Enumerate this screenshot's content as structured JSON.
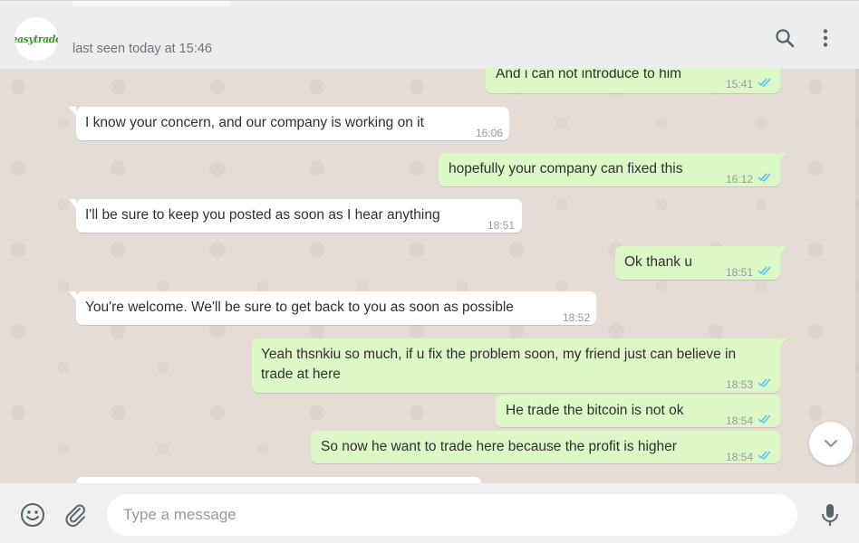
{
  "header": {
    "avatar_logo_text": "easytrade",
    "last_seen": "last seen today at 15:46",
    "icons": [
      "search-icon",
      "menu-dots-icon"
    ]
  },
  "colors": {
    "incoming_bubble": "#ffffff",
    "outgoing_bubble": "#dcf8c6",
    "read_tick": "#4fc3f7",
    "chat_background": "#e5ddd5",
    "logo_green": "#3b9c2a"
  },
  "messages": [
    {
      "direction": "out",
      "text": "And i can not introduce to him",
      "time": "15:41",
      "status": "read"
    },
    {
      "direction": "in",
      "text": "I know your concern, and our company is working on it",
      "time": "16:06"
    },
    {
      "direction": "out",
      "text": "hopefully your company can fixed this",
      "time": "16:12",
      "status": "read"
    },
    {
      "direction": "in",
      "text": "I'll be sure to keep you posted as soon as I hear anything",
      "time": "18:51"
    },
    {
      "direction": "out",
      "text": "Ok thank u",
      "time": "18:51",
      "status": "read"
    },
    {
      "direction": "in",
      "text": "You're welcome. We'll be sure to get back to you as soon as possible",
      "time": "18:52"
    },
    {
      "direction": "out",
      "text": "Yeah thsnkiu so much, if u fix the problem soon, my friend just can believe in trade at here",
      "time": "18:53",
      "status": "read"
    },
    {
      "direction": "out",
      "text": "He trade the bitcoin is not ok",
      "time": "18:54",
      "status": "read"
    },
    {
      "direction": "out",
      "text": "So now he want to trade here because the profit is higher",
      "time": "18:54",
      "status": "read"
    }
  ],
  "composer": {
    "placeholder": "Type a message",
    "icons": [
      "emoji-icon",
      "attach-icon",
      "microphone-icon"
    ]
  },
  "scroll_down_icon": "chevron-down-icon"
}
